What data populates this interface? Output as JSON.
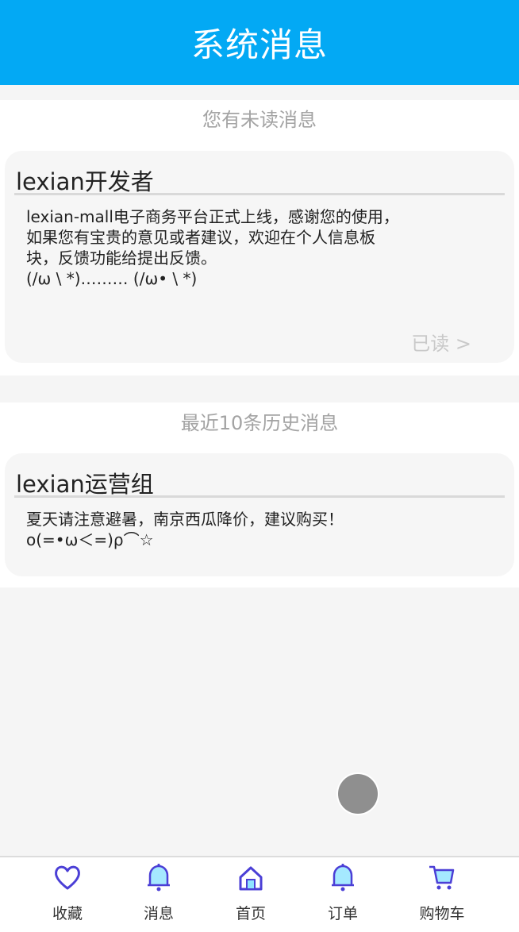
{
  "header": {
    "title": "系统消息"
  },
  "unread": {
    "title": "您有未读消息",
    "card": {
      "sender": "lexian开发者",
      "body": "lexian-mall电子商务平台正式上线，感谢您的使用，\n如果您有宝贵的意见或者建议，欢迎在个人信息板\n块，反馈功能给提出反馈。\n(/ω \\ *)……… (/ω• \\ *)",
      "read_label": "已读 >"
    }
  },
  "history": {
    "title": "最近10条历史消息",
    "card": {
      "sender": "lexian运营组",
      "body": "夏天请注意避暑，南京西瓜降价，建议购买！\no(=•ω＜=)ρ⌒☆"
    }
  },
  "tabbar": {
    "items": [
      {
        "label": "收藏",
        "icon": "heart-icon"
      },
      {
        "label": "消息",
        "icon": "bell-icon"
      },
      {
        "label": "首页",
        "icon": "home-icon"
      },
      {
        "label": "订单",
        "icon": "bell-icon"
      },
      {
        "label": "购物车",
        "icon": "cart-icon"
      }
    ]
  },
  "colors": {
    "header": "#03a9f4",
    "icon_stroke": "#4b3fd6",
    "icon_fill": "#8fe3ff"
  }
}
